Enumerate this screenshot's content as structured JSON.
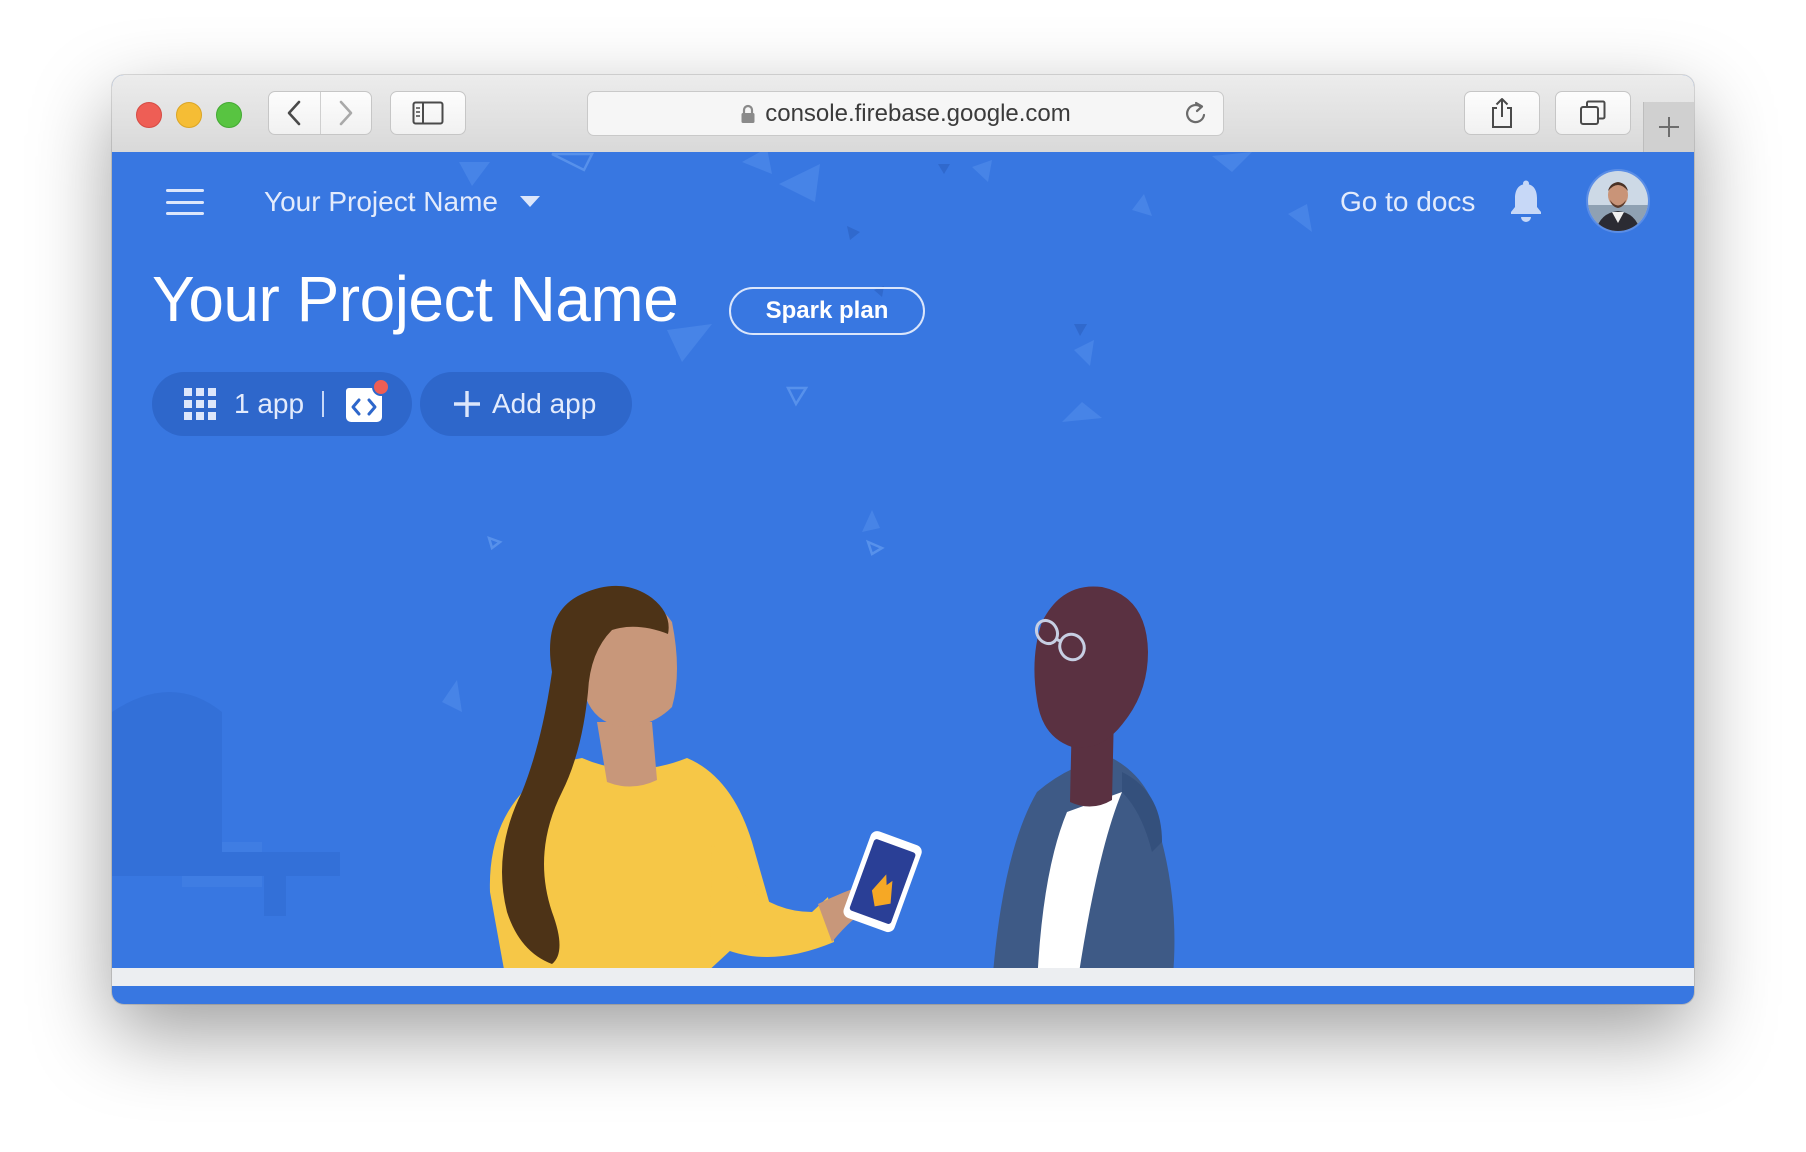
{
  "browser": {
    "url": "console.firebase.google.com"
  },
  "header": {
    "project_selector": "Your Project Name",
    "docs_link": "Go to docs"
  },
  "project": {
    "title": "Your Project Name",
    "plan": "Spark plan",
    "apps_label": "1 app",
    "add_app_label": "Add app"
  },
  "colors": {
    "page_background": "#3877e1",
    "chip_background": "#2e67cb",
    "notification_dot": "#ee5e55"
  },
  "icons": {
    "menu": "hamburger-menu-icon",
    "dropdown": "caret-down-icon",
    "notifications": "bell-icon",
    "apps": "grid-icon",
    "web_app": "code-brackets-icon",
    "add": "plus-icon",
    "lock": "lock-icon",
    "reload": "reload-icon",
    "back": "chevron-left-icon",
    "forward": "chevron-right-icon",
    "sidebar": "sidebar-icon",
    "share": "share-icon",
    "tabs": "tabs-icon",
    "new_tab": "plus-icon"
  }
}
